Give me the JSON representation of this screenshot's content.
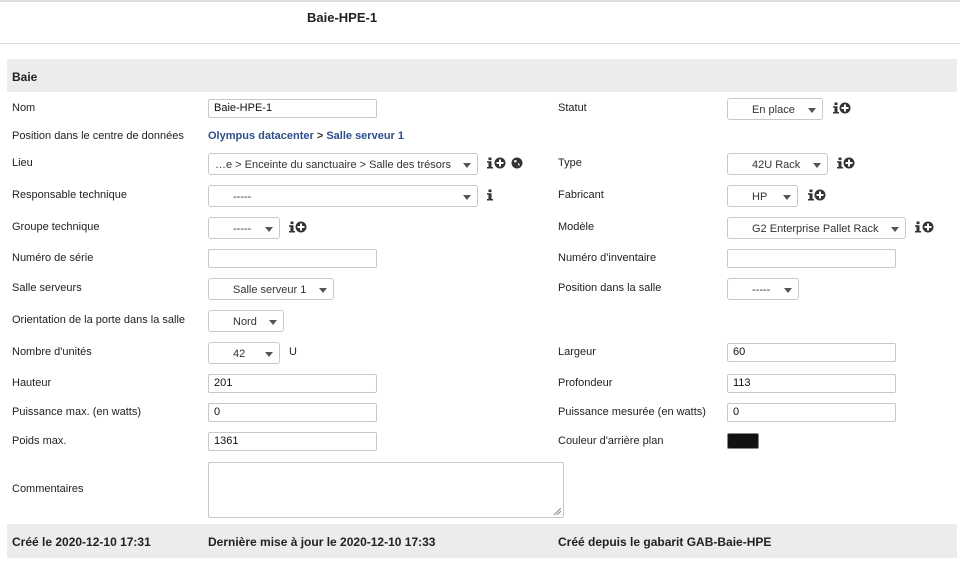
{
  "page": {
    "title": "Baie-HPE-1"
  },
  "section": {
    "title": "Baie"
  },
  "fields": {
    "nom": {
      "label": "Nom",
      "value": "Baie-HPE-1"
    },
    "statut": {
      "label": "Statut",
      "value": "En place"
    },
    "position_centre": {
      "label": "Position dans le centre de données",
      "datacenter": "Olympus datacenter",
      "separator": ">",
      "room": "Salle serveur 1"
    },
    "lieu": {
      "label": "Lieu",
      "value": "…e > Enceinte du sanctuaire > Salle des trésors"
    },
    "type": {
      "label": "Type",
      "value": "42U Rack"
    },
    "responsable": {
      "label": "Responsable technique",
      "value": "-----"
    },
    "fabricant": {
      "label": "Fabricant",
      "value": "HP"
    },
    "groupe": {
      "label": "Groupe technique",
      "value": "-----"
    },
    "modele": {
      "label": "Modèle",
      "value": "G2 Enterprise Pallet Rack"
    },
    "numero_serie": {
      "label": "Numéro de série",
      "value": ""
    },
    "numero_inventaire": {
      "label": "Numéro d'inventaire",
      "value": ""
    },
    "salle": {
      "label": "Salle serveurs",
      "value": "Salle serveur 1"
    },
    "position_salle": {
      "label": "Position dans la salle",
      "value": "-----"
    },
    "orientation": {
      "label": "Orientation de la porte dans la salle",
      "value": "Nord"
    },
    "unites": {
      "label": "Nombre d'unités",
      "value": "42",
      "unit": "U"
    },
    "largeur": {
      "label": "Largeur",
      "value": "60"
    },
    "hauteur": {
      "label": "Hauteur",
      "value": "201"
    },
    "profondeur": {
      "label": "Profondeur",
      "value": "113"
    },
    "puissance_max": {
      "label": "Puissance max. (en watts)",
      "value": "0"
    },
    "puissance_mesuree": {
      "label": "Puissance mesurée (en watts)",
      "value": "0"
    },
    "poids_max": {
      "label": "Poids max.",
      "value": "1361"
    },
    "couleur": {
      "label": "Couleur d'arrière plan",
      "color": "#111111"
    },
    "commentaires": {
      "label": "Commentaires",
      "value": ""
    }
  },
  "footer": {
    "created": "Créé le 2020-12-10 17:31",
    "updated": "Dernière mise à jour le 2020-12-10 17:33",
    "template": "Créé depuis le gabarit GAB-Baie-HPE"
  },
  "icons": [
    "info-icon",
    "add-icon",
    "globe-icon",
    "resize-grip-icon",
    "chevron-down-icon"
  ],
  "colors": {
    "link": "#2d4f8a",
    "header_bg": "#ececec",
    "border": "#c8c8c8"
  }
}
